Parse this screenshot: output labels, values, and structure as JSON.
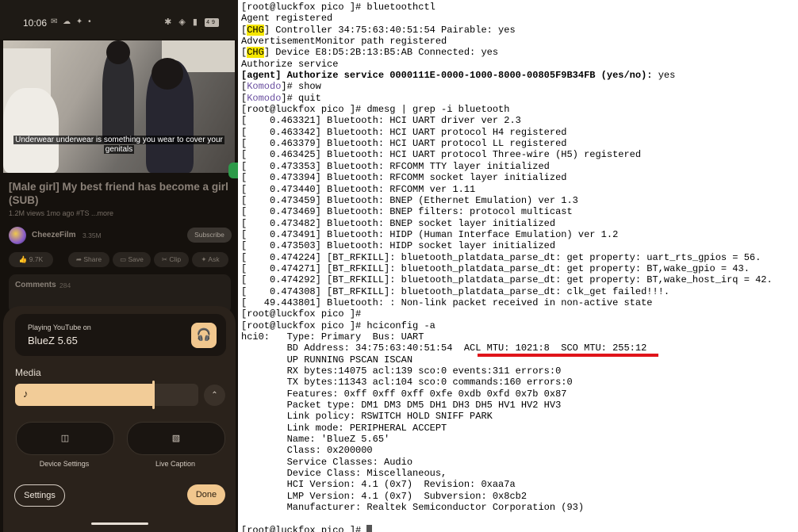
{
  "phone": {
    "status_time": "10:06",
    "status_icons_left": "✉ ☁ ✦ •",
    "status_icons_right": "✱ ◈ ▮",
    "battery": "49",
    "video": {
      "caption_line1": "Underwear underwear is something you wear to cover your",
      "caption_line2": "genitals"
    },
    "title": "[Male girl] My best friend has become a girl (SUB)",
    "meta": "1.2M views 1mo ago #TS ...more",
    "channel": {
      "name": "CheezeFilm",
      "subs": "3.35M",
      "subscribe_label": "Subscribe"
    },
    "actions": [
      {
        "icon": "thumbs-up-icon",
        "label": "👍 9.7K"
      },
      {
        "icon": "thumbs-down-icon",
        "label": "👎"
      },
      {
        "icon": "share-icon",
        "label": "➦ Share"
      },
      {
        "icon": "save-icon",
        "label": "▭ Save"
      },
      {
        "icon": "clip-icon",
        "label": "✂ Clip"
      },
      {
        "icon": "ask-icon",
        "label": "✦ Ask"
      }
    ],
    "comments": {
      "label": "Comments",
      "count": "284"
    },
    "volume_panel": {
      "playing_on": "Playing YouTube on",
      "device": "BlueZ 5.65",
      "media_label": "Media",
      "volume_level": 0.75,
      "device_settings_label": "Device Settings",
      "live_caption_label": "Live Caption",
      "settings_label": "Settings",
      "done_label": "Done"
    }
  },
  "terminal": {
    "lines": [
      [
        {
          "t": "[root@luckfox pico ]# bluetoothctl"
        }
      ],
      [
        {
          "t": "Agent registered"
        }
      ],
      [
        {
          "t": "[",
          "c": ""
        },
        {
          "t": "CHG",
          "c": "chg"
        },
        {
          "t": "] Controller 34:75:63:40:51:54 Pairable: yes"
        }
      ],
      [
        {
          "t": "AdvertisementMonitor path registered"
        }
      ],
      [
        {
          "t": "["
        },
        {
          "t": "CHG",
          "c": "chg"
        },
        {
          "t": "] Device E8:D5:2B:13:B5:AB Connected: yes"
        }
      ],
      [
        {
          "t": "Authorize service"
        }
      ],
      [
        {
          "t": "[agent] Authorize service 0000111E-0000-1000-8000-00805F9B34FB (yes/no): ",
          "c": "bold"
        },
        {
          "t": "yes"
        }
      ],
      [
        {
          "t": "["
        },
        {
          "t": "Komodo",
          "c": "komodo"
        },
        {
          "t": "]# show"
        }
      ],
      [
        {
          "t": "["
        },
        {
          "t": "Komodo",
          "c": "komodo"
        },
        {
          "t": "]# quit"
        }
      ],
      [
        {
          "t": "[root@luckfox pico ]# dmesg | grep -i bluetooth"
        }
      ],
      [
        {
          "t": "[    0.463321] Bluetooth: HCI UART driver ver 2.3"
        }
      ],
      [
        {
          "t": "[    0.463342] Bluetooth: HCI UART protocol H4 registered"
        }
      ],
      [
        {
          "t": "[    0.463379] Bluetooth: HCI UART protocol LL registered"
        }
      ],
      [
        {
          "t": "[    0.463425] Bluetooth: HCI UART protocol Three-wire (H5) registered"
        }
      ],
      [
        {
          "t": "[    0.473353] Bluetooth: RFCOMM TTY layer initialized"
        }
      ],
      [
        {
          "t": "[    0.473394] Bluetooth: RFCOMM socket layer initialized"
        }
      ],
      [
        {
          "t": "[    0.473440] Bluetooth: RFCOMM ver 1.11"
        }
      ],
      [
        {
          "t": "[    0.473459] Bluetooth: BNEP (Ethernet Emulation) ver 1.3"
        }
      ],
      [
        {
          "t": "[    0.473469] Bluetooth: BNEP filters: protocol multicast"
        }
      ],
      [
        {
          "t": "[    0.473482] Bluetooth: BNEP socket layer initialized"
        }
      ],
      [
        {
          "t": "[    0.473491] Bluetooth: HIDP (Human Interface Emulation) ver 1.2"
        }
      ],
      [
        {
          "t": "[    0.473503] Bluetooth: HIDP socket layer initialized"
        }
      ],
      [
        {
          "t": "[    0.474224] [BT_RFKILL]: bluetooth_platdata_parse_dt: get property: uart_rts_gpios = 56."
        }
      ],
      [
        {
          "t": "[    0.474271] [BT_RFKILL]: bluetooth_platdata_parse_dt: get property: BT,wake_gpio = 43."
        }
      ],
      [
        {
          "t": "[    0.474292] [BT_RFKILL]: bluetooth_platdata_parse_dt: get property: BT,wake_host_irq = 42."
        }
      ],
      [
        {
          "t": "[    0.474308] [BT_RFKILL]: bluetooth_platdata_parse_dt: clk_get failed!!!."
        }
      ],
      [
        {
          "t": "[   49.443801] Bluetooth: : Non-link packet received in non-active state"
        }
      ],
      [
        {
          "t": "[root@luckfox pico ]#"
        }
      ],
      [
        {
          "t": "[root@luckfox pico ]# hciconfig -a"
        }
      ],
      [
        {
          "t": "hci0:   Type: Primary  Bus: UART"
        }
      ],
      [
        {
          "t": "        BD Address: 34:75:63:40:51:54  ACL MTU: 1021:8  SCO MTU: 255:12"
        }
      ],
      [
        {
          "t": "        UP RUNNING PSCAN ISCAN"
        }
      ],
      [
        {
          "t": "        RX bytes:14075 acl:139 sco:0 events:311 errors:0"
        }
      ],
      [
        {
          "t": "        TX bytes:11343 acl:104 sco:0 commands:160 errors:0"
        }
      ],
      [
        {
          "t": "        Features: 0xff 0xff 0xff 0xfe 0xdb 0xfd 0x7b 0x87"
        }
      ],
      [
        {
          "t": "        Packet type: DM1 DM3 DM5 DH1 DH3 DH5 HV1 HV2 HV3"
        }
      ],
      [
        {
          "t": "        Link policy: RSWITCH HOLD SNIFF PARK"
        }
      ],
      [
        {
          "t": "        Link mode: PERIPHERAL ACCEPT"
        }
      ],
      [
        {
          "t": "        Name: 'BlueZ 5.65'"
        }
      ],
      [
        {
          "t": "        Class: 0x200000"
        }
      ],
      [
        {
          "t": "        Service Classes: Audio"
        }
      ],
      [
        {
          "t": "        Device Class: Miscellaneous,"
        }
      ],
      [
        {
          "t": "        HCI Version: 4.1 (0x7)  Revision: 0xaa7a"
        }
      ],
      [
        {
          "t": "        LMP Version: 4.1 (0x7)  Subversion: 0x8cb2"
        }
      ],
      [
        {
          "t": "        Manufacturer: Realtek Semiconductor Corporation (93)"
        }
      ],
      [
        {
          "t": ""
        }
      ],
      [
        {
          "t": "[root@luckfox pico ]# "
        }
      ]
    ],
    "colors": {
      "chg_highlight": "#f5e600",
      "komodo": "#6a4fa0",
      "underline": "#e0141a"
    }
  }
}
